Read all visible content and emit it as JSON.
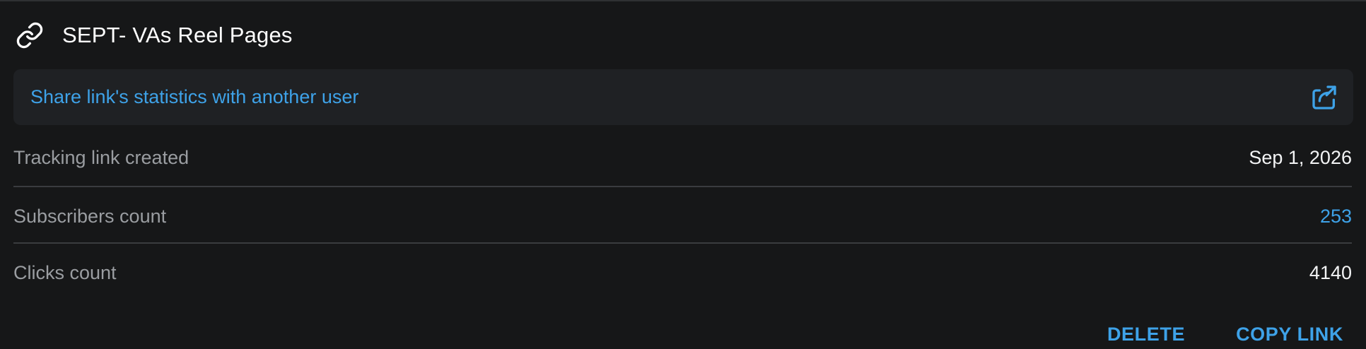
{
  "header": {
    "icon": "link-icon",
    "title": "SEPT- VAs Reel Pages"
  },
  "share": {
    "label": "Share link's statistics with another user",
    "icon": "share-icon"
  },
  "details": [
    {
      "label": "Tracking link created",
      "value": "Sep 1, 2026"
    },
    {
      "label": "Subscribers count",
      "value": "253"
    },
    {
      "label": "Clicks count",
      "value": "4140"
    }
  ],
  "actions": {
    "delete_label": "DELETE",
    "copy_label": "COPY LINK"
  },
  "colors": {
    "background": "#161718",
    "accent": "#3ea2e8",
    "share_bg": "#1f2124",
    "label": "#9a9da1",
    "value": "#f3f4f5"
  }
}
